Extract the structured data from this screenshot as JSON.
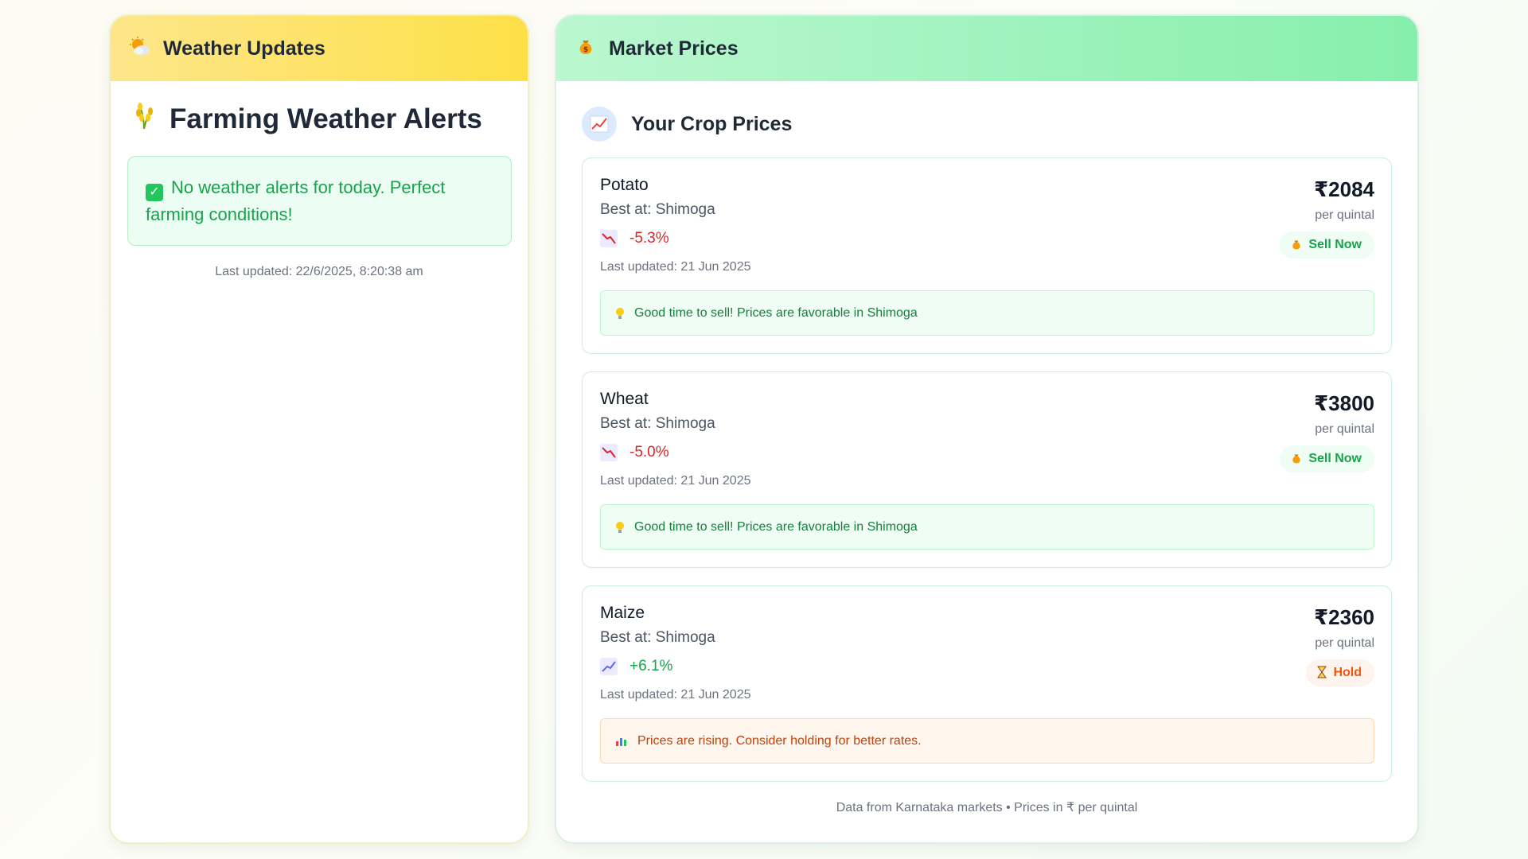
{
  "weather": {
    "header": "Weather Updates",
    "header_icon": "sun-behind-cloud-icon",
    "title": "Farming Weather Alerts",
    "title_icon": "wheat-icon",
    "alert_text": "No weather alerts for today. Perfect farming conditions!",
    "last_updated": "Last updated: 22/6/2025, 8:20:38 am"
  },
  "market": {
    "header": "Market Prices",
    "header_icon": "money-bag-icon",
    "subheader": "Your Crop Prices",
    "subheader_icon": "chart-increasing-icon",
    "crops": [
      {
        "name": "Potato",
        "best_at": "Best at: Shimoga",
        "change": "-5.3%",
        "trend": "down",
        "last_updated": "Last updated: 21 Jun 2025",
        "price": "₹2084",
        "unit": "per quintal",
        "action": "Sell Now",
        "action_type": "sell",
        "advice": "Good time to sell! Prices are favorable in Shimoga",
        "advice_type": "good"
      },
      {
        "name": "Wheat",
        "best_at": "Best at: Shimoga",
        "change": "-5.0%",
        "trend": "down",
        "last_updated": "Last updated: 21 Jun 2025",
        "price": "₹3800",
        "unit": "per quintal",
        "action": "Sell Now",
        "action_type": "sell",
        "advice": "Good time to sell! Prices are favorable in Shimoga",
        "advice_type": "good"
      },
      {
        "name": "Maize",
        "best_at": "Best at: Shimoga",
        "change": "+6.1%",
        "trend": "up",
        "last_updated": "Last updated: 21 Jun 2025",
        "price": "₹2360",
        "unit": "per quintal",
        "action": "Hold",
        "action_type": "hold",
        "advice": "Prices are rising. Consider holding for better rates.",
        "advice_type": "warn"
      }
    ],
    "footer": "Data from Karnataka markets • Prices in ₹ per quintal"
  },
  "colors": {
    "weather_header": "#fde047",
    "market_header": "#86efac",
    "positive": "#16a34a",
    "negative": "#dc2626",
    "hold": "#ea580c"
  }
}
